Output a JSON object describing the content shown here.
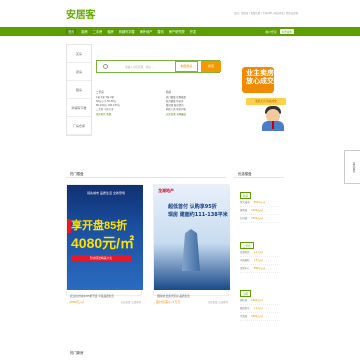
{
  "header": {
    "logo": "安居客",
    "top_links": "您好，请登录 | 免费注册 | 手机APP | 网站导航 | 我的安居客"
  },
  "nav": {
    "items": [
      "首页",
      "新房",
      "二手房",
      "租房",
      "商铺写字楼",
      "海外地产",
      "楼讯",
      "房产研究院",
      "开发"
    ],
    "active_index": 0,
    "user_label": "用户登录",
    "publish_label": "免费发布"
  },
  "sidebar": {
    "items": [
      "买房",
      "卖房",
      "租房",
      "商铺写字楼",
      "厂房仓库"
    ]
  },
  "search": {
    "placeholder": "请输入小区名称、地址…",
    "map_button": "地图找房",
    "search_button": "搜索"
  },
  "quick_links": {
    "col1_title": "二手房",
    "col1": [
      "1室 2室 3室 4室",
      "50万以下 50-80万",
      "80-100万 100-150万",
      "二手房 小区大全"
    ],
    "col1_red": "找房委托 免费",
    "col2_title": "新房",
    "col2": [
      "热门楼盘 优惠楼盘",
      "新开楼盘 特价房",
      "看房团 新房资讯",
      "购房工具 新房问答"
    ],
    "col2_red": "买房优惠 全网最低"
  },
  "promo": {
    "headline": "业主卖房\n放心成交",
    "button": "我要卖房 快速成交"
  },
  "feedback_tab": "意见反馈",
  "sections": {
    "hot_new": "热门楼盘",
    "hot_deals": "热门看房",
    "recommended": "优选楼盘",
    "bottom": "热门新房"
  },
  "cards": [
    {
      "banner_title": "领先城市 品质生活 全新登场",
      "banner_big": "享开盘85折",
      "banner_num": "4080元/㎡",
      "banner_gift": "到访即送精美大礼",
      "caption": "武汉恒大绿洲 85折开盘 享受品质生活",
      "price": "4080元/㎡",
      "meta": "周边配套 交通便利"
    },
    {
      "banner_logo": "龙湖地产",
      "banner_line1": "超低首付 认购享95折",
      "banner_line2": "现房 建面约111-138平米",
      "caption": "国际城 优质学区房 品质生活",
      "price": "首付仅需3~5万元",
      "meta": "周边配套 交通便利"
    }
  ],
  "right_panel": {
    "tags": [
      "新房",
      "二手房",
      "小区"
    ],
    "items": [
      {
        "name": "恒大绿洲",
        "val": "8500元/㎡"
      },
      {
        "name": "保利城",
        "val": "9200元/㎡"
      },
      {
        "name": "万科城",
        "val": "7800元/㎡"
      },
      {
        "name": "龙湖天街",
        "val": "1.2万/㎡"
      },
      {
        "name": "中海国际",
        "val": "1.5万/㎡"
      },
      {
        "name": "金地中心",
        "val": "8800元/㎡"
      },
      {
        "name": "碧桂园",
        "val": "6900元/㎡"
      },
      {
        "name": "融创壹号",
        "val": "1.1万/㎡"
      },
      {
        "name": "华润城",
        "val": "9600元/㎡"
      }
    ]
  }
}
